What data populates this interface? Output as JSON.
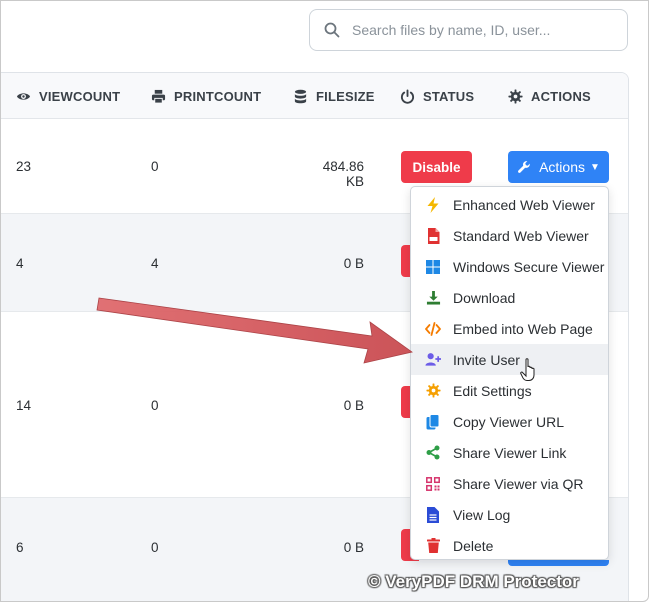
{
  "search": {
    "placeholder": "Search files by name, ID, user..."
  },
  "table": {
    "headers": [
      {
        "label": "VIEWCOUNT",
        "icon": "eye-icon"
      },
      {
        "label": "PRINTCOUNT",
        "icon": "printer-icon"
      },
      {
        "label": "FILESIZE",
        "icon": "database-icon"
      },
      {
        "label": "STATUS",
        "icon": "power-icon"
      },
      {
        "label": "ACTIONS",
        "icon": "gear-icon"
      }
    ],
    "rows": [
      {
        "viewcount": "23",
        "printcount": "0",
        "filesize": "484.86 KB",
        "status_button": "Disable",
        "actions_button": "Actions"
      },
      {
        "viewcount": "4",
        "printcount": "4",
        "filesize": "0 B"
      },
      {
        "viewcount": "14",
        "printcount": "0",
        "filesize": "0 B"
      },
      {
        "viewcount": "6",
        "printcount": "0",
        "filesize": "0 B"
      }
    ]
  },
  "menu": {
    "items": [
      {
        "label": "Enhanced Web Viewer",
        "icon": "bolt-icon",
        "color": "#f5b800"
      },
      {
        "label": "Standard Web Viewer",
        "icon": "pdf-file-icon",
        "color": "#e03131"
      },
      {
        "label": "Windows Secure Viewer",
        "icon": "windows-icon",
        "color": "#1e88e5"
      },
      {
        "label": "Download",
        "icon": "download-icon",
        "color": "#2e7d32"
      },
      {
        "label": "Embed into Web Page",
        "icon": "code-icon",
        "color": "#f57c00"
      },
      {
        "label": "Invite User",
        "icon": "user-plus-icon",
        "color": "#6c5ce7"
      },
      {
        "label": "Edit Settings",
        "icon": "gear-icon",
        "color": "#f59f00"
      },
      {
        "label": "Copy Viewer URL",
        "icon": "copy-icon",
        "color": "#1e88e5"
      },
      {
        "label": "Share Viewer Link",
        "icon": "share-icon",
        "color": "#2e9e47"
      },
      {
        "label": "Share Viewer via QR",
        "icon": "qrcode-icon",
        "color": "#d6336c"
      },
      {
        "label": "View Log",
        "icon": "file-text-icon",
        "color": "#2b4cd6"
      },
      {
        "label": "Delete",
        "icon": "trash-icon",
        "color": "#e03131"
      }
    ]
  },
  "watermark": "© VeryPDF DRM Protector",
  "colors": {
    "danger": "#ef3b4a",
    "primary": "#2f83f6",
    "arrow": "#d6585c"
  }
}
